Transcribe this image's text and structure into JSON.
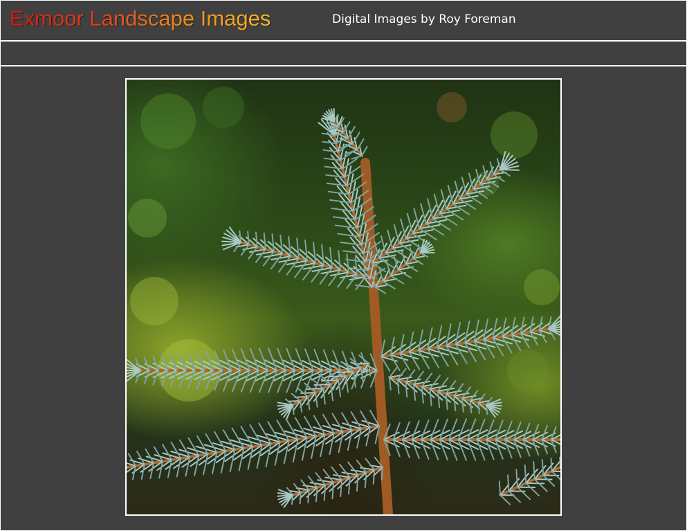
{
  "header": {
    "site_title": "Exmoor Landscape Images",
    "site_subtitle": "Digital Images by Roy Foreman"
  },
  "photo": {
    "subject": "blue spruce branch close-up"
  },
  "colors": {
    "background": "#404040",
    "rule": "#ffffff",
    "title_gradient_start": "#d01a10",
    "title_gradient_end": "#f4b72a",
    "subtitle": "#ffffff"
  }
}
